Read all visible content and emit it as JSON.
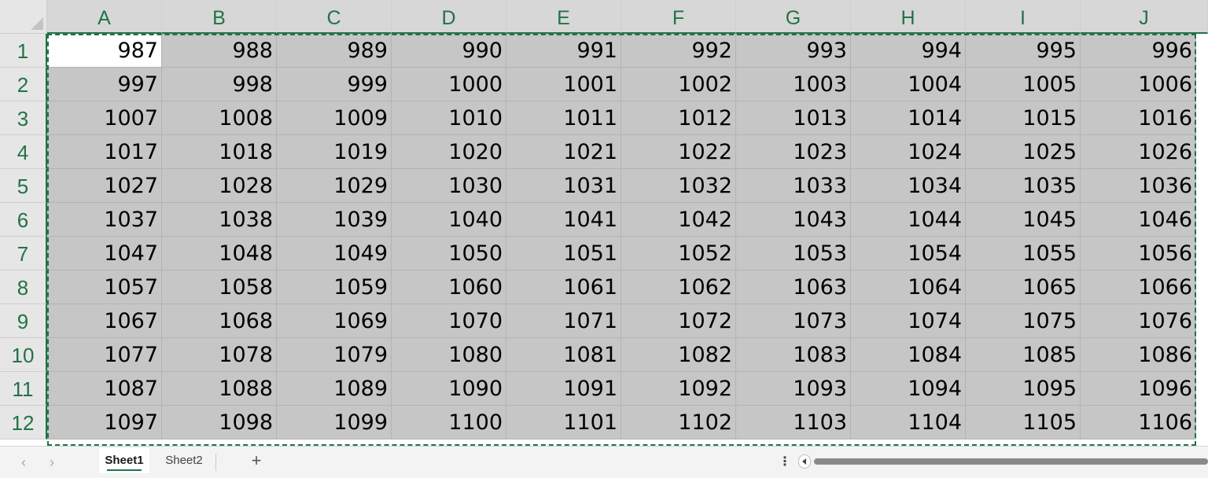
{
  "columns": [
    "A",
    "B",
    "C",
    "D",
    "E",
    "F",
    "G",
    "H",
    "I",
    "J"
  ],
  "rows": [
    "1",
    "2",
    "3",
    "4",
    "5",
    "6",
    "7",
    "8",
    "9",
    "10",
    "11",
    "12"
  ],
  "cells": [
    [
      "987",
      "988",
      "989",
      "990",
      "991",
      "992",
      "993",
      "994",
      "995",
      "996"
    ],
    [
      "997",
      "998",
      "999",
      "1000",
      "1001",
      "1002",
      "1003",
      "1004",
      "1005",
      "1006"
    ],
    [
      "1007",
      "1008",
      "1009",
      "1010",
      "1011",
      "1012",
      "1013",
      "1014",
      "1015",
      "1016"
    ],
    [
      "1017",
      "1018",
      "1019",
      "1020",
      "1021",
      "1022",
      "1023",
      "1024",
      "1025",
      "1026"
    ],
    [
      "1027",
      "1028",
      "1029",
      "1030",
      "1031",
      "1032",
      "1033",
      "1034",
      "1035",
      "1036"
    ],
    [
      "1037",
      "1038",
      "1039",
      "1040",
      "1041",
      "1042",
      "1043",
      "1044",
      "1045",
      "1046"
    ],
    [
      "1047",
      "1048",
      "1049",
      "1050",
      "1051",
      "1052",
      "1053",
      "1054",
      "1055",
      "1056"
    ],
    [
      "1057",
      "1058",
      "1059",
      "1060",
      "1061",
      "1062",
      "1063",
      "1064",
      "1065",
      "1066"
    ],
    [
      "1067",
      "1068",
      "1069",
      "1070",
      "1071",
      "1072",
      "1073",
      "1074",
      "1075",
      "1076"
    ],
    [
      "1077",
      "1078",
      "1079",
      "1080",
      "1081",
      "1082",
      "1083",
      "1084",
      "1085",
      "1086"
    ],
    [
      "1087",
      "1088",
      "1089",
      "1090",
      "1091",
      "1092",
      "1093",
      "1094",
      "1095",
      "1096"
    ],
    [
      "1097",
      "1098",
      "1099",
      "1100",
      "1101",
      "1102",
      "1103",
      "1104",
      "1105",
      "1106"
    ]
  ],
  "active_cell": "A1",
  "sheet_tabs": [
    {
      "label": "Sheet1",
      "active": true
    },
    {
      "label": "Sheet2",
      "active": false
    }
  ],
  "icons": {
    "prev_sheet": "chevron-left-icon",
    "next_sheet": "chevron-right-icon",
    "add_sheet": "plus-icon",
    "more": "vertical-ellipsis-icon",
    "scroll_left": "scroll-left-icon"
  },
  "colors": {
    "accent": "#217346",
    "selection_fill": "#c6c6c6",
    "header_fill": "#e6e6e6"
  }
}
